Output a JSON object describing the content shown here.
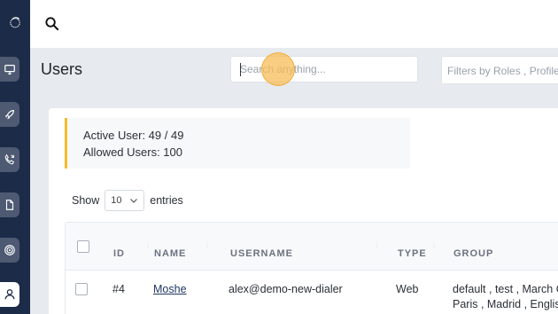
{
  "app": {
    "brand_glyph": "ି"
  },
  "sidebar": {
    "items": [
      {
        "icon": "monitor-icon"
      },
      {
        "icon": "rocket-icon"
      },
      {
        "icon": "phone-callback-icon"
      },
      {
        "icon": "document-icon"
      },
      {
        "icon": "target-icon"
      },
      {
        "icon": "user-icon",
        "active": true
      }
    ]
  },
  "topbar": {
    "search_icon": "search-icon"
  },
  "page": {
    "title": "Users",
    "search_placeholder": "Search anything...",
    "filter_placeholder": "Filters by Roles , Profiles"
  },
  "info": {
    "active_users": "Active User: 49 / 49",
    "allowed_users": "Allowed Users: 100"
  },
  "entries": {
    "show_label": "Show",
    "value": "10",
    "entries_label": "entries"
  },
  "table": {
    "headers": [
      "ID",
      "NAME",
      "USERNAME",
      "TYPE",
      "GROUP"
    ],
    "rows": [
      {
        "id": "#4",
        "name": "Moshe",
        "username": "alex@demo-new-dialer",
        "type": "Web",
        "group_line1": "default , test , March C",
        "group_line2": "Paris , Madrid , English"
      }
    ]
  },
  "colors": {
    "sidebar": "#1c2b47",
    "accent": "#f4bb2b",
    "link": "#1f3763"
  }
}
